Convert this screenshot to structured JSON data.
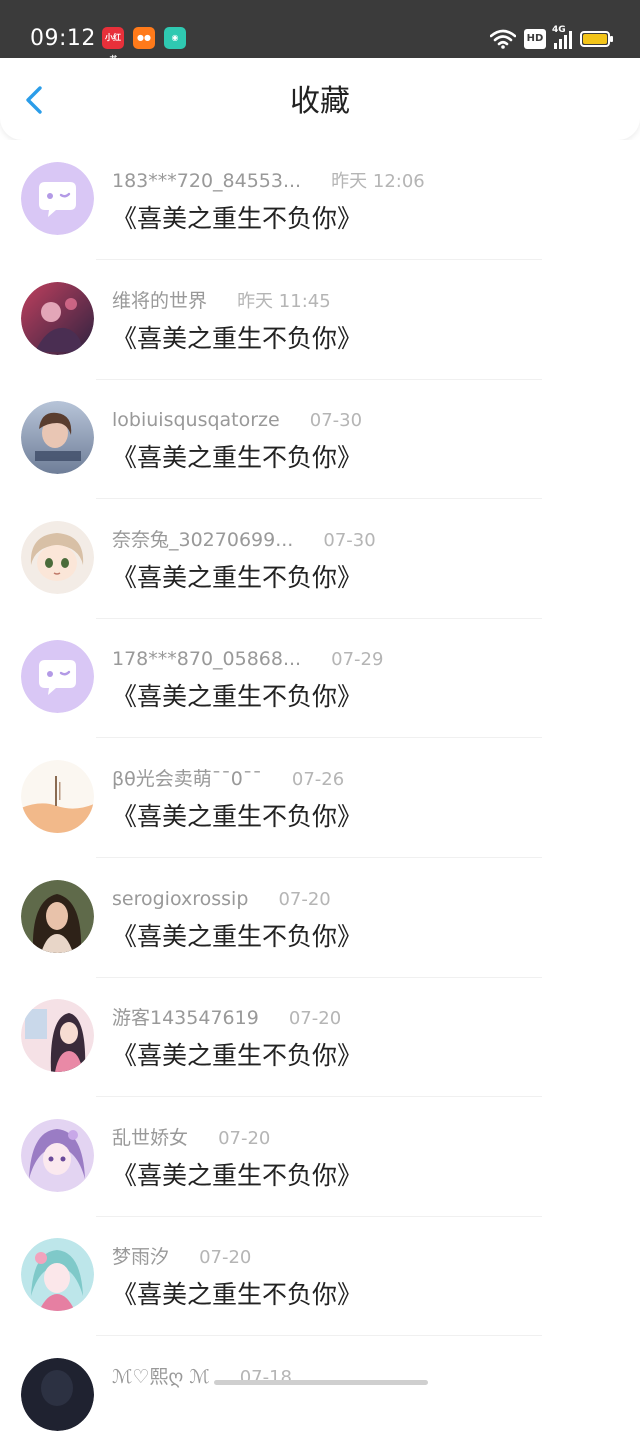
{
  "status_bar": {
    "time": "09:12",
    "notification_icons": [
      "xiaohongshu-icon",
      "dianping-icon",
      "chat-app-icon"
    ],
    "network": "4G",
    "hd_label": "HD",
    "battery_color": "#f2c419"
  },
  "header": {
    "title": "收藏",
    "back_icon": "chevron-left-icon",
    "accent_color": "#2b9de9"
  },
  "favorites": [
    {
      "user": "183***720_84553...",
      "time": "昨天 12:06",
      "title": "《喜美之重生不负你》",
      "avatar": "default-chat-avatar"
    },
    {
      "user": "维将的世界",
      "time": "昨天 11:45",
      "title": "《喜美之重生不负你》",
      "avatar": "photo-avatar"
    },
    {
      "user": "lobiuisqusqatorze",
      "time": "07-30",
      "title": "《喜美之重生不负你》",
      "avatar": "photo-avatar"
    },
    {
      "user": "奈奈兔_30270699...",
      "time": "07-30",
      "title": "《喜美之重生不负你》",
      "avatar": "anime-avatar"
    },
    {
      "user": "178***870_05868...",
      "time": "07-29",
      "title": "《喜美之重生不负你》",
      "avatar": "default-chat-avatar"
    },
    {
      "user": "βθ光会卖萌¯¯0¯¯",
      "time": "07-26",
      "title": "《喜美之重生不负你》",
      "avatar": "book-cover-avatar"
    },
    {
      "user": "serogioxrossip",
      "time": "07-20",
      "title": "《喜美之重生不负你》",
      "avatar": "photo-avatar"
    },
    {
      "user": "游客143547619",
      "time": "07-20",
      "title": "《喜美之重生不负你》",
      "avatar": "anime-avatar"
    },
    {
      "user": "乱世娇女",
      "time": "07-20",
      "title": "《喜美之重生不负你》",
      "avatar": "anime-avatar"
    },
    {
      "user": "梦雨汐",
      "time": "07-20",
      "title": "《喜美之重生不负你》",
      "avatar": "anime-avatar"
    },
    {
      "user": "ℳ♡熙ღ ℳ",
      "time": "07-18",
      "title": "",
      "avatar": "photo-avatar"
    }
  ]
}
